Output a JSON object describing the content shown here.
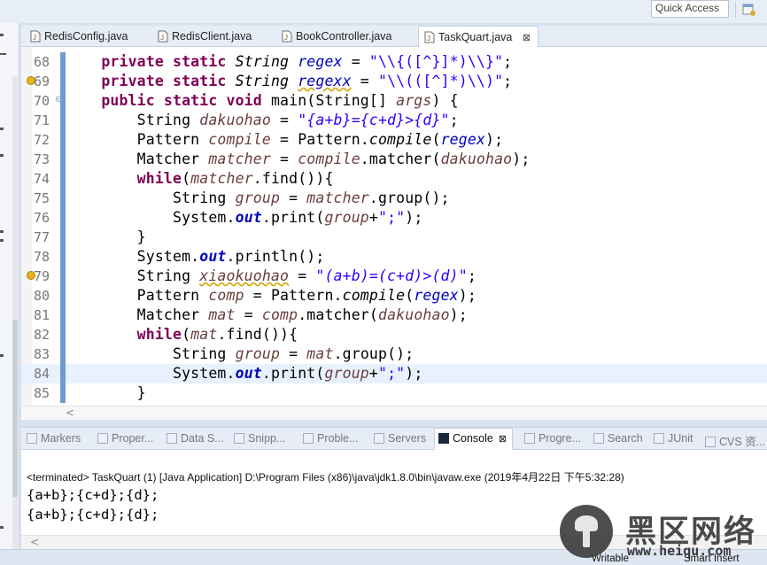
{
  "toolbar": {
    "quick_access": "Quick Access"
  },
  "editor_tabs": [
    {
      "label": "RedisConfig.java",
      "active": false
    },
    {
      "label": "RedisClient.java",
      "active": false
    },
    {
      "label": "BookController.java",
      "active": false
    },
    {
      "label": "TaskQuart.java",
      "active": true,
      "close": "⊠"
    }
  ],
  "code_lines": [
    {
      "num": "68",
      "segs": [
        [
          "    ",
          ""
        ],
        [
          "private static ",
          "kw"
        ],
        [
          "String ",
          "it"
        ],
        [
          "regex",
          "fld"
        ],
        [
          " = ",
          ""
        ],
        [
          "\"\\\\{([^}]*)\\\\}\"",
          "str"
        ],
        [
          ";",
          ""
        ]
      ]
    },
    {
      "num": "69",
      "warn": true,
      "segs": [
        [
          "    ",
          ""
        ],
        [
          "private static ",
          "kw"
        ],
        [
          "String ",
          "it"
        ],
        [
          "regexx",
          "fld wv"
        ],
        [
          " = ",
          ""
        ],
        [
          "\"\\\\(([^]*)\\\\)\"",
          "str"
        ],
        [
          ";",
          ""
        ]
      ]
    },
    {
      "num": "70",
      "fold": true,
      "segs": [
        [
          "    ",
          ""
        ],
        [
          "public static void ",
          "kw"
        ],
        [
          "main(String[] ",
          ""
        ],
        [
          "args",
          "var"
        ],
        [
          ") {",
          ""
        ]
      ]
    },
    {
      "num": "71",
      "segs": [
        [
          "        ",
          ""
        ],
        [
          "String ",
          ""
        ],
        [
          "dakuohao",
          "var"
        ],
        [
          " = ",
          ""
        ],
        [
          "\"{a+b}={c+d}>{d}\"",
          "str it"
        ],
        [
          ";",
          ""
        ]
      ]
    },
    {
      "num": "72",
      "segs": [
        [
          "        ",
          ""
        ],
        [
          "Pattern ",
          ""
        ],
        [
          "compile",
          "var"
        ],
        [
          " = Pattern.",
          ""
        ],
        [
          "compile",
          "it"
        ],
        [
          "(",
          ""
        ],
        [
          "regex",
          "fld"
        ],
        [
          ");",
          ""
        ]
      ]
    },
    {
      "num": "73",
      "segs": [
        [
          "        ",
          ""
        ],
        [
          "Matcher ",
          ""
        ],
        [
          "matcher",
          "var"
        ],
        [
          " = ",
          ""
        ],
        [
          "compile",
          "var"
        ],
        [
          ".matcher(",
          ""
        ],
        [
          "dakuohao",
          "var"
        ],
        [
          ");",
          ""
        ]
      ]
    },
    {
      "num": "74",
      "segs": [
        [
          "        ",
          ""
        ],
        [
          "while",
          "kw"
        ],
        [
          "(",
          ""
        ],
        [
          "matcher",
          "var"
        ],
        [
          ".find()){",
          ""
        ]
      ]
    },
    {
      "num": "75",
      "segs": [
        [
          "            ",
          ""
        ],
        [
          "String ",
          ""
        ],
        [
          "group",
          "var"
        ],
        [
          " = ",
          ""
        ],
        [
          "matcher",
          "var"
        ],
        [
          ".group();",
          ""
        ]
      ]
    },
    {
      "num": "76",
      "segs": [
        [
          "            ",
          ""
        ],
        [
          "System.",
          ""
        ],
        [
          "out",
          "sfld"
        ],
        [
          ".print(",
          ""
        ],
        [
          "group",
          "var"
        ],
        [
          "+",
          ""
        ],
        [
          "\";\"",
          "str"
        ],
        [
          ");",
          ""
        ]
      ]
    },
    {
      "num": "77",
      "segs": [
        [
          "        }",
          ""
        ]
      ]
    },
    {
      "num": "78",
      "segs": [
        [
          "        ",
          ""
        ],
        [
          "System.",
          ""
        ],
        [
          "out",
          "sfld"
        ],
        [
          ".println();",
          ""
        ]
      ]
    },
    {
      "num": "79",
      "warn": true,
      "segs": [
        [
          "        ",
          ""
        ],
        [
          "String ",
          ""
        ],
        [
          "xiaokuohao",
          "var wv"
        ],
        [
          " = ",
          ""
        ],
        [
          "\"(a+b)=(c+d)>(d)\"",
          "str it"
        ],
        [
          ";",
          ""
        ]
      ]
    },
    {
      "num": "80",
      "segs": [
        [
          "        ",
          ""
        ],
        [
          "Pattern ",
          ""
        ],
        [
          "comp",
          "var"
        ],
        [
          " = Pattern.",
          ""
        ],
        [
          "compile",
          "it"
        ],
        [
          "(",
          ""
        ],
        [
          "regex",
          "fld"
        ],
        [
          ");",
          ""
        ]
      ]
    },
    {
      "num": "81",
      "segs": [
        [
          "        ",
          ""
        ],
        [
          "Matcher ",
          ""
        ],
        [
          "mat",
          "var"
        ],
        [
          " = ",
          ""
        ],
        [
          "comp",
          "var"
        ],
        [
          ".matcher(",
          ""
        ],
        [
          "dakuohao",
          "var"
        ],
        [
          ");",
          ""
        ]
      ]
    },
    {
      "num": "82",
      "segs": [
        [
          "        ",
          ""
        ],
        [
          "while",
          "kw"
        ],
        [
          "(",
          ""
        ],
        [
          "mat",
          "var"
        ],
        [
          ".find()){",
          ""
        ]
      ]
    },
    {
      "num": "83",
      "segs": [
        [
          "            ",
          ""
        ],
        [
          "String ",
          ""
        ],
        [
          "group",
          "var"
        ],
        [
          " = ",
          ""
        ],
        [
          "mat",
          "var"
        ],
        [
          ".group();",
          ""
        ]
      ]
    },
    {
      "num": "84",
      "highlight": true,
      "segs": [
        [
          "            ",
          ""
        ],
        [
          "System.",
          ""
        ],
        [
          "out",
          "sfld"
        ],
        [
          ".print(",
          ""
        ],
        [
          "group",
          "var"
        ],
        [
          "+",
          ""
        ],
        [
          "\";\"",
          "str"
        ],
        [
          ");",
          ""
        ]
      ]
    },
    {
      "num": "85",
      "segs": [
        [
          "        }",
          ""
        ]
      ]
    }
  ],
  "view_tabs": [
    {
      "label": "Markers"
    },
    {
      "label": "Proper..."
    },
    {
      "label": "Data S..."
    },
    {
      "label": "Snipp..."
    },
    {
      "label": "Proble..."
    },
    {
      "label": "Servers"
    },
    {
      "label": "Console",
      "active": true,
      "close": "⊠"
    },
    {
      "label": "Progre..."
    },
    {
      "label": "Search"
    },
    {
      "label": "JUnit"
    },
    {
      "label": "CVS 资..."
    }
  ],
  "console": {
    "terminated": "<terminated> TaskQuart (1) [Java Application] D:\\Program Files (x86)\\java\\jdk1.8.0\\bin\\javaw.exe (2019年4月22日 下午5:32:28)",
    "output": [
      "{a+b};{c+d};{d};",
      "{a+b};{c+d};{d};"
    ]
  },
  "status": {
    "writable": "Writable",
    "insert": "Smart Insert"
  },
  "watermark": {
    "text": "黑区网络",
    "url": "www.heiqu.com"
  }
}
